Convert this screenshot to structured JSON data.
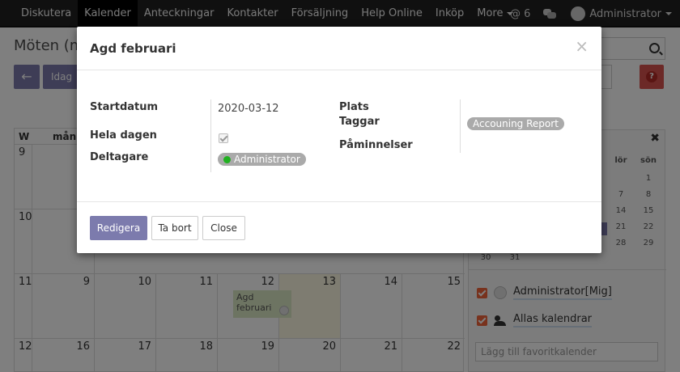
{
  "navbar": {
    "menu": [
      "Diskutera",
      "Kalender",
      "Anteckningar",
      "Kontakter",
      "Försäljning",
      "Help Online",
      "Inköp",
      "More"
    ],
    "active_index": 1,
    "mentions": "@ 6",
    "user": "Administrator"
  },
  "background": {
    "title": "Möten (m",
    "today_label": "Idag",
    "calendar": {
      "week_header": "W",
      "day_header": "mån",
      "rows": [
        {
          "week": "9",
          "days": [
            "",
            "",
            "",
            "",
            "",
            "",
            ""
          ]
        },
        {
          "week": "10",
          "days": [
            "",
            "",
            "",
            "",
            "",
            "",
            ""
          ]
        },
        {
          "week": "11",
          "days": [
            "9",
            "10",
            "11",
            "12",
            "13",
            "14",
            "15"
          ]
        },
        {
          "week": "12",
          "days": [
            "16",
            "17",
            "18",
            "19",
            "20",
            "21",
            "22"
          ]
        }
      ],
      "event": "Agd februari"
    },
    "mini_calendar": {
      "headers": [
        "lör",
        "sön"
      ],
      "rows": [
        [
          "",
          "1"
        ],
        [
          "7",
          "8"
        ],
        [
          "14",
          "15"
        ],
        [
          "21",
          "22"
        ],
        [
          "28",
          "29"
        ]
      ],
      "last_row": [
        "30",
        "31"
      ]
    },
    "favorites": [
      {
        "label": "Administrator[Mig]",
        "icon": "avatar-icon"
      },
      {
        "label": "Allas kalendrar",
        "icon": "people-icon"
      }
    ],
    "favorite_placeholder": "Lägg till favoritkalender"
  },
  "modal": {
    "title": "Agd februari",
    "close_symbol": "×",
    "fields": {
      "start_label": "Startdatum",
      "start_value": "2020-03-12",
      "allday_label": "Hela dagen",
      "attendees_label": "Deltagare",
      "attendee": "Administrator",
      "location_label": "Plats",
      "tags_label": "Taggar",
      "tag": "Accouning Report",
      "reminders_label": "Påminnelser"
    },
    "buttons": {
      "edit": "Redigera",
      "delete": "Ta bort",
      "close": "Close"
    }
  },
  "colors": {
    "primary": "#7c7bad",
    "navbar": "#212121",
    "tag": "#aaaaaa",
    "status_online": "#21b121",
    "checkbox": "#f0643a"
  }
}
